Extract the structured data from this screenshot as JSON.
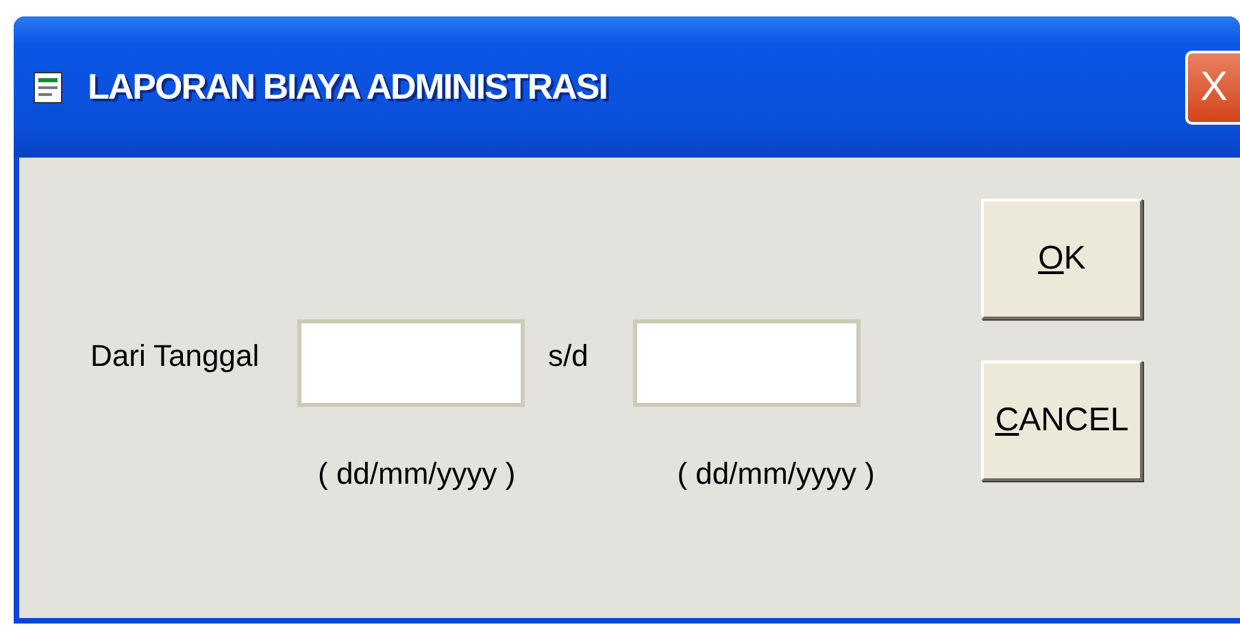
{
  "window": {
    "title": "LAPORAN BIAYA ADMINISTRASI",
    "close": "X"
  },
  "form": {
    "from_label": "Dari Tanggal",
    "separator": "s/d",
    "from_hint": "( dd/mm/yyyy )",
    "to_hint": "( dd/mm/yyyy )"
  },
  "buttons": [
    {
      "label": "OK"
    },
    {
      "label": "CANCEL"
    }
  ]
}
